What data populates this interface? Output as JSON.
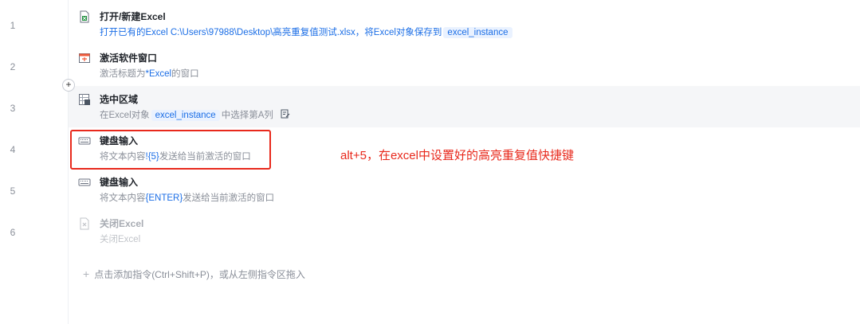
{
  "line_numbers": [
    "1",
    "2",
    "3",
    "4",
    "5",
    "6"
  ],
  "steps": [
    {
      "title": "打开/新建Excel",
      "desc_text": "打开已有的Excel C:\\Users\\97988\\Desktop\\高亮重复值测试.xlsx，将Excel对象保存到",
      "desc_tag": "excel_instance",
      "icon": "excel-file-icon"
    },
    {
      "title": "激活软件窗口",
      "desc_prefix": "激活标题为",
      "desc_value": "*Excel",
      "desc_suffix": "的窗口",
      "icon": "window-icon"
    },
    {
      "title": "选中区域",
      "desc_prefix": "在Excel对象",
      "desc_tag": "excel_instance",
      "desc_suffix": "中选择第A列",
      "icon": "excel-select-icon"
    },
    {
      "title": "键盘输入",
      "desc_prefix": "将文本内容",
      "desc_value": "!{5}",
      "desc_suffix": "发送给当前激活的窗口",
      "icon": "keyboard-icon"
    },
    {
      "title": "键盘输入",
      "desc_prefix": "将文本内容",
      "desc_value": "{ENTER}",
      "desc_suffix": "发送给当前激活的窗口",
      "icon": "keyboard-icon"
    },
    {
      "title": "关闭Excel",
      "desc_text": "关闭Excel",
      "icon": "excel-close-icon",
      "disabled": true
    }
  ],
  "annotation": "alt+5，在excel中设置好的高亮重复值快捷键",
  "add_hint": "点击添加指令(Ctrl+Shift+P)，或从左侧指令区拖入",
  "colors": {
    "accent": "#1b6ee6",
    "annotation_red": "#e8291c"
  }
}
